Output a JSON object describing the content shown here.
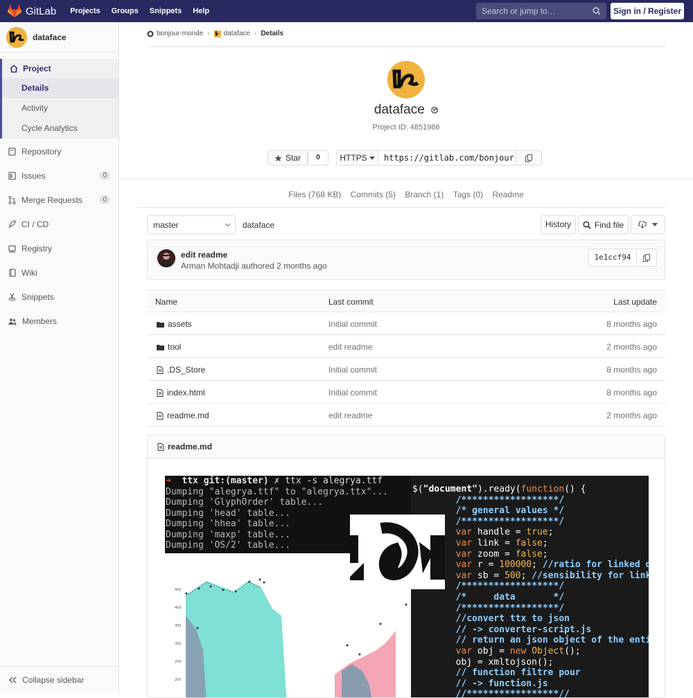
{
  "topbar": {
    "brand": "GitLab",
    "nav": [
      "Projects",
      "Groups",
      "Snippets",
      "Help"
    ],
    "search_placeholder": "Search or jump to…",
    "signin": "Sign in / Register"
  },
  "sidebar": {
    "project_name": "dataface",
    "section": "Project",
    "subitems": [
      "Details",
      "Activity",
      "Cycle Analytics"
    ],
    "items": [
      {
        "label": "Repository",
        "icon": "repository-icon"
      },
      {
        "label": "Issues",
        "icon": "issues-icon",
        "count": "0"
      },
      {
        "label": "Merge Requests",
        "icon": "merge-request-icon",
        "count": "0"
      },
      {
        "label": "CI / CD",
        "icon": "rocket-icon"
      },
      {
        "label": "Registry",
        "icon": "registry-icon"
      },
      {
        "label": "Wiki",
        "icon": "book-icon"
      },
      {
        "label": "Snippets",
        "icon": "scissors-icon"
      },
      {
        "label": "Members",
        "icon": "users-icon"
      }
    ],
    "collapse": "Collapse sidebar"
  },
  "breadcrumb": [
    "bonjour-monde",
    "dataface",
    "Details"
  ],
  "project": {
    "title": "dataface",
    "id_text": "Project ID: 4851986",
    "star_label": "Star",
    "star_count": "0",
    "protocol": "HTTPS",
    "clone_url": "https://gitlab.com/bonjour-m"
  },
  "stats": [
    "Files (768 KB)",
    "Commits (5)",
    "Branch (1)",
    "Tags (0)",
    "Readme"
  ],
  "repo": {
    "branch": "master",
    "path": "dataface",
    "history": "History",
    "find_file": "Find file"
  },
  "commit": {
    "title": "edit readme",
    "author": "Arman Mohtadji authored 2 months ago",
    "sha": "1e1ccf94"
  },
  "table": {
    "headers": [
      "Name",
      "Last commit",
      "Last update"
    ],
    "rows": [
      {
        "name": "assets",
        "type": "folder",
        "commit": "Initial commit",
        "updated": "8 months ago"
      },
      {
        "name": "tool",
        "type": "folder",
        "commit": "edit readme",
        "updated": "2 months ago"
      },
      {
        "name": ".DS_Store",
        "type": "file",
        "commit": "Initial commit",
        "updated": "8 months ago"
      },
      {
        "name": "index.html",
        "type": "file",
        "commit": "Initial commit",
        "updated": "8 months ago"
      },
      {
        "name": "readme.md",
        "type": "file",
        "commit": "edit readme",
        "updated": "2 months ago"
      }
    ]
  },
  "readme": {
    "title": "readme.md",
    "terminal_prompt": "➜",
    "terminal_repo": "ttx git:(master)",
    "terminal_cmd": "✗ ttx -s alegrya.ttf",
    "terminal_lines": [
      "Dumping \"alegrya.ttf\" to \"alegrya.ttx\"...",
      "Dumping 'GlyphOrder' table...",
      "Dumping 'head' table...",
      "Dumping 'hhea' table...",
      "Dumping 'maxp' table...",
      "Dumping 'OS/2' table..."
    ],
    "chart_ticks": [
      "450",
      "400",
      "350",
      "300",
      "250",
      "200"
    ]
  },
  "colors": {
    "topbar": "#292961",
    "accent": "#4b4ba3"
  }
}
